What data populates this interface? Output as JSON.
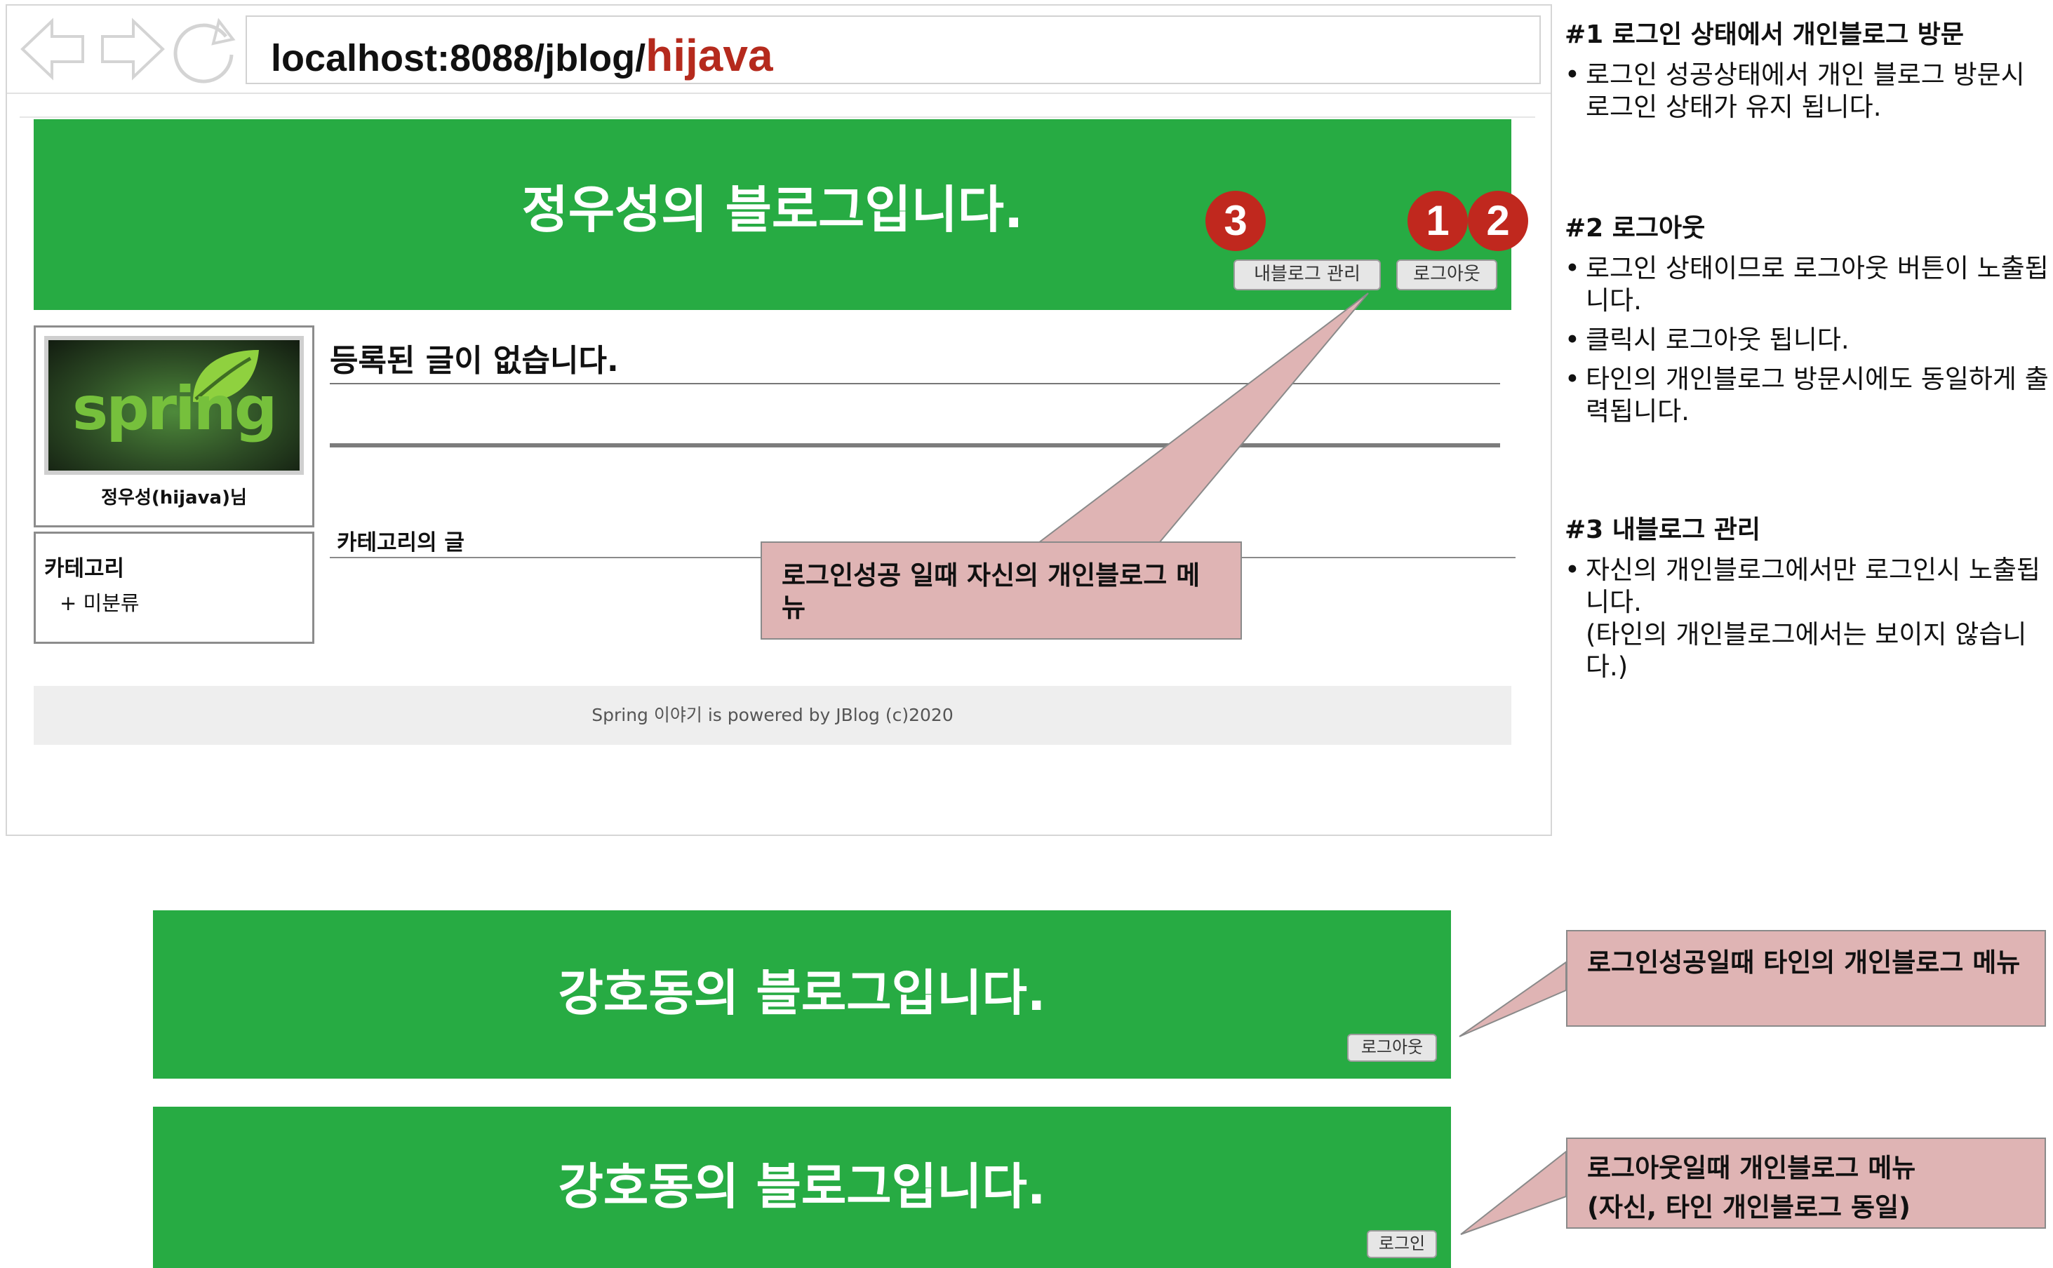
{
  "browser": {
    "url_prefix": "localhost:8088/jblog/",
    "url_highlight": "hijava"
  },
  "blog_main": {
    "title": "정우성의 블로그입니다.",
    "buttons": {
      "manage": "내블로그 관리",
      "logout": "로그아웃"
    },
    "badges": [
      "3",
      "1",
      "2"
    ],
    "profile": {
      "logo_text": "spring",
      "name": "정우성(hijava)님"
    },
    "category_box": {
      "title": "카테고리",
      "item": "+ 미분류"
    },
    "post": {
      "title": "등록된 글이 없습니다."
    },
    "category_posts_label": "카테고리의 글",
    "footer": "Spring 이야기 is powered by JBlog (c)2020"
  },
  "callouts": {
    "own_menu": "로그인성공 일때 자신의 개인블로그 메뉴",
    "other_menu": "로그인성공일때 타인의 개인블로그 메뉴",
    "logout_menu_line1": "로그아웃일때 개인블로그 메뉴",
    "logout_menu_line2": "(자신, 타인 개인블로그 동일)"
  },
  "blog_other": {
    "title": "강호동의 블로그입니다.",
    "logout": "로그아웃"
  },
  "blog_logged_out": {
    "title": "강호동의 블로그입니다.",
    "login": "로그인"
  },
  "notes": [
    {
      "heading": "#1 로그인 상태에서 개인블로그 방문",
      "items": [
        "로그인 성공상태에서 개인 블로그 방문시 로그인 상태가 유지 됩니다."
      ]
    },
    {
      "heading": "#2 로그아웃",
      "items": [
        "로그인 상태이므로 로그아웃 버튼이 노출됩니다.",
        "클릭시 로그아웃 됩니다.",
        "타인의 개인블로그 방문시에도 동일하게 출력됩니다."
      ]
    },
    {
      "heading": "#3 내블로그 관리",
      "items": [
        "자신의 개인블로그에서만 로그인시 노출됩니다.",
        "(타인의 개인블로그에서는 보이지 않습니다.)"
      ]
    }
  ],
  "colors": {
    "header_green": "#27ab43",
    "badge_red": "#c0281e",
    "callout_pink": "#dfb4b4"
  }
}
